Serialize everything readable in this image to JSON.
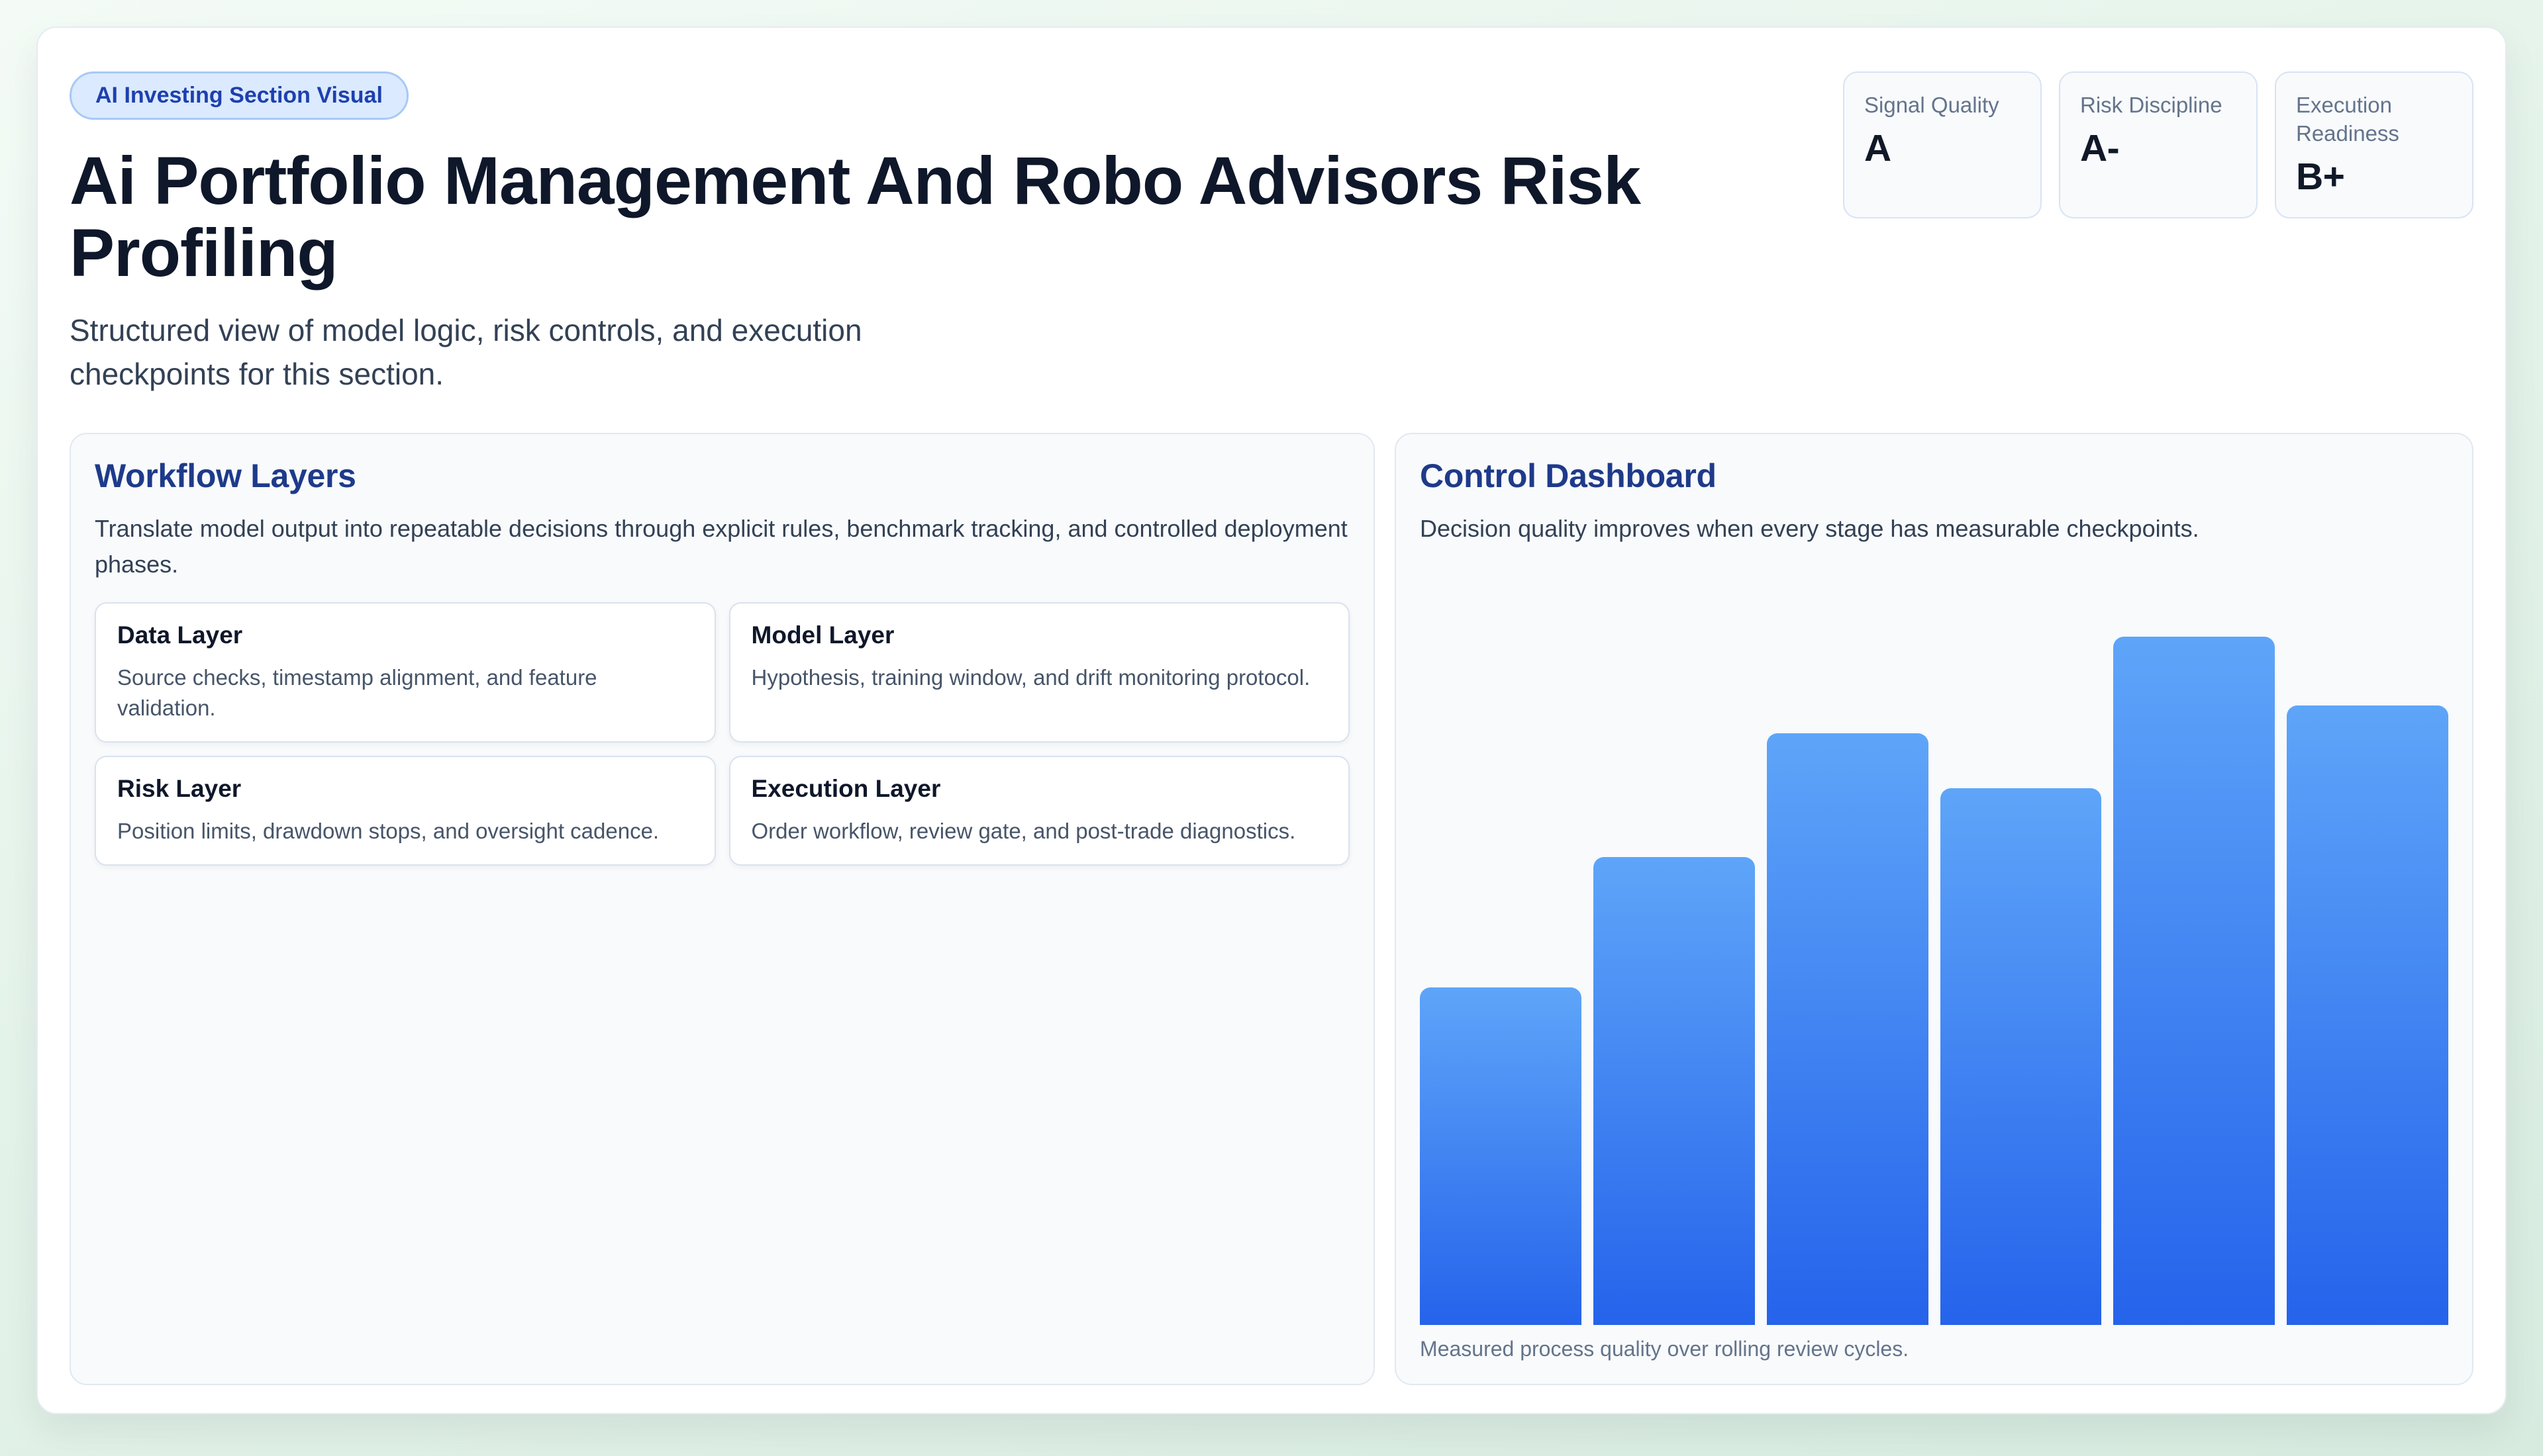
{
  "header": {
    "badge": "AI Investing Section Visual",
    "title": "Ai Portfolio Management And Robo Advisors Risk Profiling",
    "subtitle": "Structured view of model logic, risk controls, and execution checkpoints for this section.",
    "stats": [
      {
        "label": "Signal Quality",
        "value": "A"
      },
      {
        "label": "Risk Discipline",
        "value": "A-"
      },
      {
        "label": "Execution Readiness",
        "value": "B+"
      }
    ]
  },
  "workflow_panel": {
    "title": "Workflow Layers",
    "description": "Translate model output into repeatable decisions through explicit rules, benchmark tracking, and controlled deployment phases.",
    "layers": [
      {
        "title": "Data Layer",
        "description": "Source checks, timestamp alignment, and feature validation."
      },
      {
        "title": "Model Layer",
        "description": "Hypothesis, training window, and drift monitoring protocol."
      },
      {
        "title": "Risk Layer",
        "description": "Position limits, drawdown stops, and oversight cadence."
      },
      {
        "title": "Execution Layer",
        "description": "Order workflow, review gate, and post-trade diagnostics."
      }
    ]
  },
  "dashboard_panel": {
    "title": "Control Dashboard",
    "description": "Decision quality improves when every stage has measurable checkpoints.",
    "caption": "Measured process quality over rolling review cycles."
  },
  "chart_data": {
    "type": "bar",
    "title": "Control Dashboard",
    "subtitle": "Decision quality improves when every stage has measurable checkpoints.",
    "caption": "Measured process quality over rolling review cycles.",
    "x": [
      1,
      2,
      3,
      4,
      5,
      6
    ],
    "x_tick_labels_visible": false,
    "y_axis_visible": false,
    "grid": false,
    "legend": false,
    "values": [
      49,
      68,
      86,
      78,
      100,
      90
    ],
    "value_unit": "percent of tallest bar, estimated from bar pixel heights",
    "ylim": [
      0,
      100
    ],
    "bar_gradient_top": "#5ea5f9",
    "bar_gradient_bottom": "#2563eb"
  },
  "colors": {
    "page_background_green": "#e4f3ea",
    "card_background": "#ffffff",
    "panel_background": "#f8fafc",
    "panel_border": "#e2e8f0",
    "badge_background": "#dbeafe",
    "badge_border": "#a8c9f6",
    "badge_text": "#1e40af",
    "heading_dark": "#0f172a",
    "heading_blue": "#1e3a8a",
    "body_text": "#334155",
    "muted_text": "#64748b",
    "accent_blue": "#2563eb",
    "bar_top_blue": "#5ea5f9"
  }
}
